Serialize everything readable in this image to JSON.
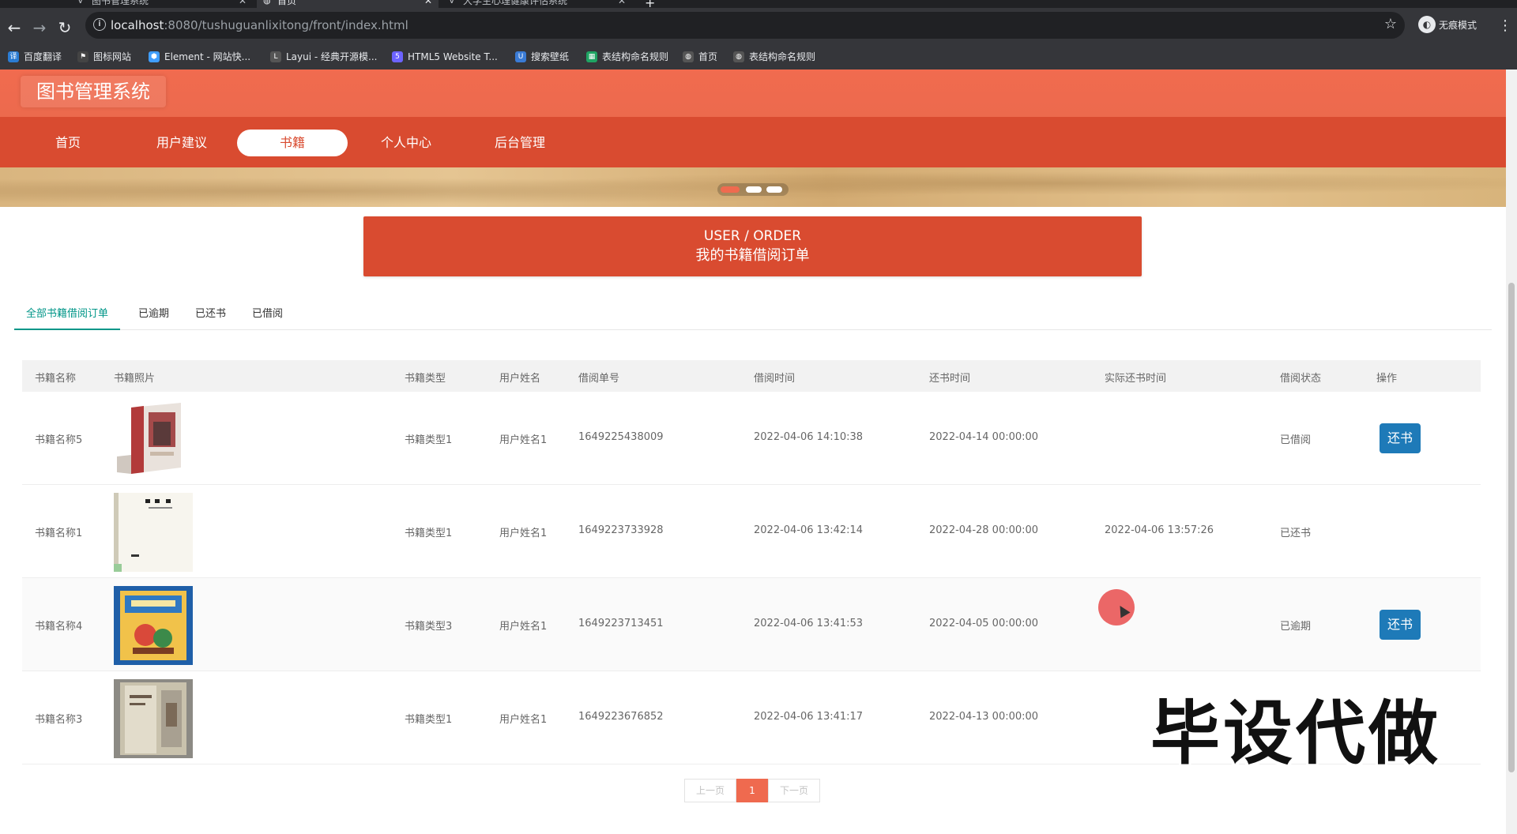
{
  "browser": {
    "tabs": [
      {
        "label": "图书管理系统",
        "favicon": "vue-icon",
        "active": false
      },
      {
        "label": "首页",
        "favicon": "globe-icon",
        "active": true
      },
      {
        "label": "大学生心理健康评估系统",
        "favicon": "vue-icon",
        "active": false
      }
    ],
    "url_host": "localhost",
    "url_rest": ":8080/tushuguanlixitong/front/index.html",
    "incognito_label": "无痕模式",
    "bookmarks": [
      {
        "label": "百度翻译",
        "icon": "translate-icon",
        "color": "#2b7cd3"
      },
      {
        "label": "图标网站",
        "icon": "flag-icon",
        "color": "#444"
      },
      {
        "label": "Element - 网站快...",
        "icon": "element-icon",
        "color": "#409eff"
      },
      {
        "label": "Layui - 经典开源模...",
        "icon": "layui-icon",
        "color": "#555"
      },
      {
        "label": "HTML5 Website T...",
        "icon": "html5-icon",
        "color": "#6c63ff"
      },
      {
        "label": "搜索壁纸",
        "icon": "wallpaper-icon",
        "color": "#3a7bd5"
      },
      {
        "label": "表结构命名规则",
        "icon": "sheet-icon",
        "color": "#1fa463"
      },
      {
        "label": "首页",
        "icon": "globe-icon",
        "color": "#555"
      },
      {
        "label": "表结构命名规则",
        "icon": "globe-icon",
        "color": "#555"
      }
    ]
  },
  "site": {
    "logo": "图书管理系统",
    "nav": [
      "首页",
      "用户建议",
      "书籍",
      "个人中心",
      "后台管理"
    ],
    "active_nav": "书籍"
  },
  "order_title": {
    "en": "USER / ORDER",
    "cn": "我的书籍借阅订单"
  },
  "filter_tabs": [
    "全部书籍借阅订单",
    "已逾期",
    "已还书",
    "已借阅"
  ],
  "table": {
    "headers": [
      "书籍名称",
      "书籍照片",
      "书籍类型",
      "用户姓名",
      "借阅单号",
      "借阅时间",
      "还书时间",
      "实际还书时间",
      "借阅状态",
      "操作"
    ],
    "rows": [
      {
        "name": "书籍名称5",
        "type": "书籍类型1",
        "user": "用户姓名1",
        "no": "1649225438009",
        "borrow": "2022-04-06 14:10:38",
        "due": "2022-04-14 00:00:00",
        "actual": "",
        "status": "已借阅",
        "action": "还书"
      },
      {
        "name": "书籍名称1",
        "type": "书籍类型1",
        "user": "用户姓名1",
        "no": "1649223733928",
        "borrow": "2022-04-06 13:42:14",
        "due": "2022-04-28 00:00:00",
        "actual": "2022-04-06 13:57:26",
        "status": "已还书",
        "action": ""
      },
      {
        "name": "书籍名称4",
        "type": "书籍类型3",
        "user": "用户姓名1",
        "no": "1649223713451",
        "borrow": "2022-04-06 13:41:53",
        "due": "2022-04-05 00:00:00",
        "actual": "",
        "status": "已逾期",
        "action": "还书"
      },
      {
        "name": "书籍名称3",
        "type": "书籍类型1",
        "user": "用户姓名1",
        "no": "1649223676852",
        "borrow": "2022-04-06 13:41:17",
        "due": "2022-04-13 00:00:00",
        "actual": "",
        "status": "",
        "action": ""
      }
    ]
  },
  "pager": {
    "prev": "上一页",
    "current": "1",
    "next": "下一页"
  },
  "watermark": "毕设代做"
}
